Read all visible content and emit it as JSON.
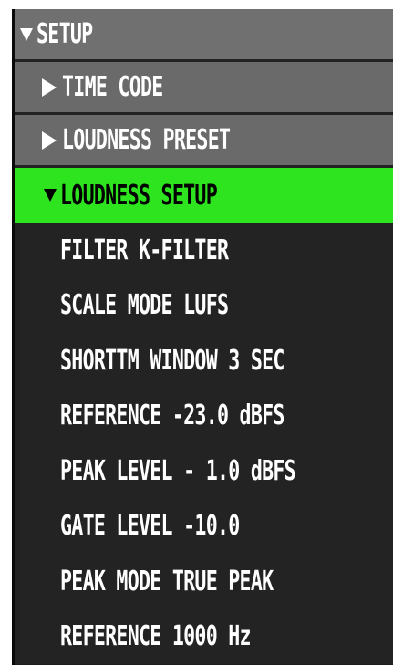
{
  "menu": {
    "header": {
      "label": "SETUP"
    },
    "submenus": [
      {
        "label": "TIME CODE"
      },
      {
        "label": "LOUDNESS PRESET"
      }
    ],
    "active": {
      "label": "LOUDNESS SETUP"
    },
    "items": [
      {
        "label": "FILTER K-FILTER"
      },
      {
        "label": "SCALE MODE LUFS"
      },
      {
        "label": "SHORTTM WINDOW 3  SEC"
      },
      {
        "label": "REFERENCE   -23.0  dBFS"
      },
      {
        "label": "PEAK  LEVEL  -  1.0  dBFS"
      },
      {
        "label": "GATE LEVEL  -10.0"
      },
      {
        "label": "PEAK MODE TRUE  PEAK"
      },
      {
        "label": "REFERENCE     1000  Hz"
      }
    ]
  },
  "colors": {
    "panel_bg": "#1c1c1c",
    "header_bg": "#707070",
    "submenu_bg": "#6a6a6a",
    "active_bg": "#2ee41e",
    "text": "#ffffff",
    "active_text": "#000000"
  },
  "icons": {
    "expanded": "triangle-down-icon",
    "collapsed": "triangle-right-icon"
  }
}
